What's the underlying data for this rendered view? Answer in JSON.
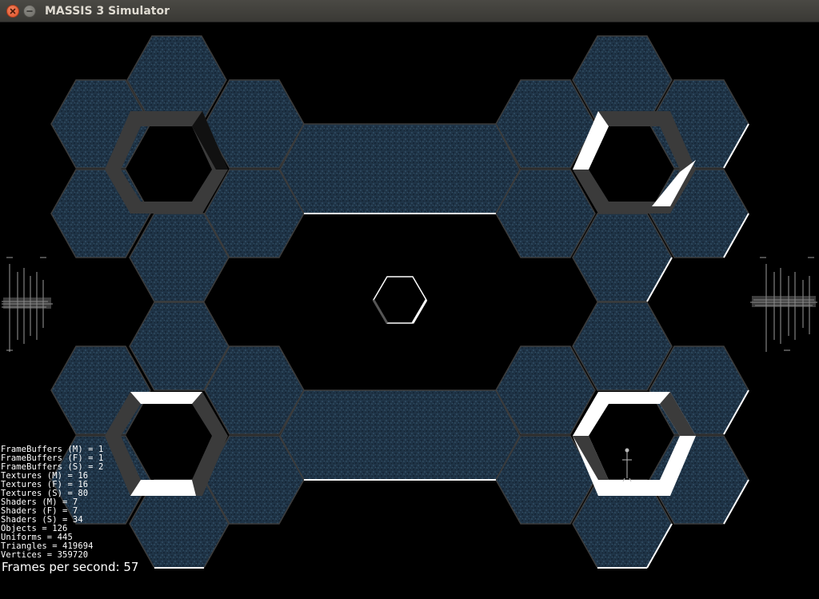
{
  "window": {
    "title": "MASSIS 3 Simulator"
  },
  "colors": {
    "floor": "#1f3447",
    "floor_edge": "#3a3a3a",
    "pillar": "#3b3b3b",
    "highlight": "#ffffff"
  },
  "icons": {
    "close": "close-icon",
    "minimize": "minimize-icon"
  },
  "stats": [
    "FrameBuffers (M) = 1",
    "FrameBuffers (F) = 1",
    "FrameBuffers (S) = 2",
    "Textures (M) = 16",
    "Textures (F) = 16",
    "Textures (S) = 80",
    "Shaders (M) = 7",
    "Shaders (F) = 7",
    "Shaders (S) = 34",
    "Objects = 126",
    "Uniforms = 445",
    "Triangles = 419694",
    "Vertices = 359720"
  ],
  "fps": "Frames per second: 57"
}
